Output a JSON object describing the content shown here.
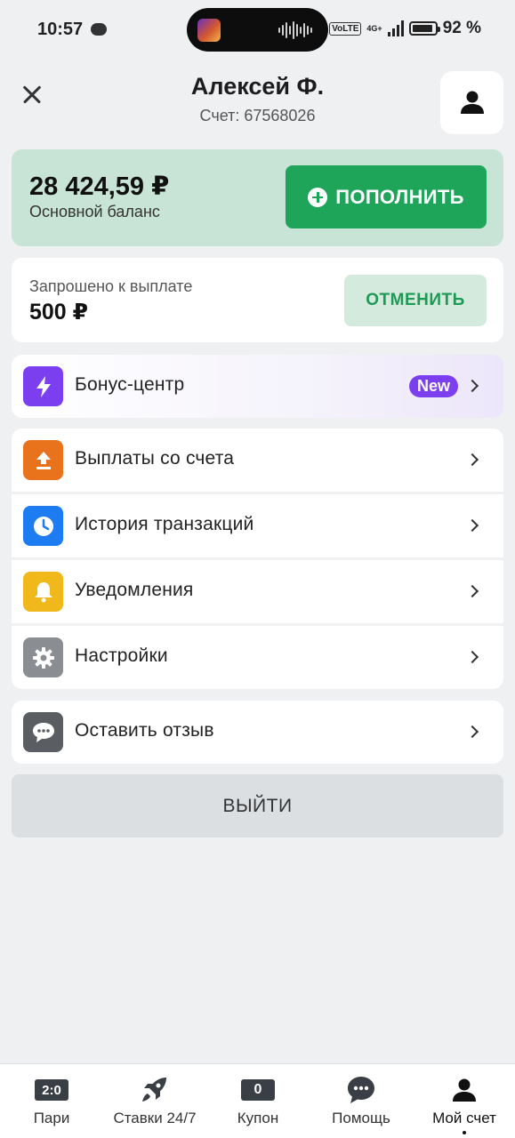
{
  "status_bar": {
    "time": "10:57",
    "volte": "VoLTE",
    "network": "4G+",
    "battery_percent": 92,
    "battery_text": "92 %"
  },
  "header": {
    "name": "Алексей Ф.",
    "account": "Счет: 67568026"
  },
  "balance": {
    "amount": "28 424,59 ₽",
    "label": "Основной баланс",
    "topup_label": "ПОПОЛНИТЬ"
  },
  "payout": {
    "label": "Запрошено к выплате",
    "amount": "500 ₽",
    "cancel_label": "ОТМЕНИТЬ"
  },
  "bonus": {
    "label": "Бонус-центр",
    "badge": "New"
  },
  "menu": {
    "payouts": "Выплаты со счета",
    "history": "История транзакций",
    "notifications": "Уведомления",
    "settings": "Настройки",
    "feedback": "Оставить отзыв"
  },
  "logout_label": "ВЫЙТИ",
  "bottom_nav": {
    "bets": {
      "label": "Пари",
      "badge": "2:0"
    },
    "live": {
      "label": "Ставки 24/7"
    },
    "coupon": {
      "label": "Купон",
      "count": "0"
    },
    "help": {
      "label": "Помощь"
    },
    "account": {
      "label": "Мой счет"
    }
  },
  "colors": {
    "accent_green": "#1ea55a",
    "bonus_purple": "#7b3ff0",
    "payout_icon": "#e8731c",
    "history_icon": "#1d7cf2",
    "notifications_icon": "#f0b81a",
    "settings_icon": "#8a8d91",
    "feedback_icon": "#5a5e63"
  }
}
